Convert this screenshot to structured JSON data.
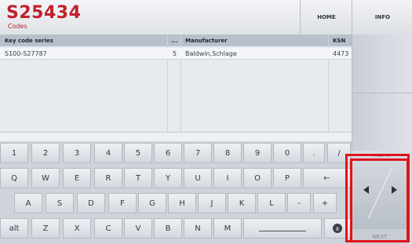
{
  "header": {
    "title": "S25434",
    "subtitle": "Codes",
    "home": "HOME",
    "info": "INFO"
  },
  "table": {
    "columns": {
      "series": "Key code series",
      "dash": "...",
      "manufacturer": "Manufacturer",
      "ksn": "KSN"
    },
    "rows": [
      {
        "series": "S100-S27787",
        "count": "5",
        "manufacturer": "Baldwin,Schlage",
        "ksn": "4473"
      }
    ]
  },
  "nav": {
    "back": "BACK",
    "next": "NEXT",
    "left_icon": "arrow-left-icon",
    "right_icon": "arrow-right-icon"
  },
  "keyboard": {
    "row1": [
      "1",
      "2",
      "3",
      "4",
      "5",
      "6",
      "7",
      "8",
      "9",
      "0",
      ".",
      "/"
    ],
    "row2": [
      "Q",
      "W",
      "E",
      "R",
      "T",
      "Y",
      "U",
      "I",
      "O",
      "P",
      "←"
    ],
    "row3": [
      "A",
      "S",
      "D",
      "F",
      "G",
      "H",
      "J",
      "K",
      "L",
      "-",
      "+"
    ],
    "row4": [
      "alt",
      "Z",
      "X",
      "C",
      "V",
      "B",
      "N",
      "M"
    ],
    "delete": "x"
  },
  "highlight_color": "#e0141b"
}
